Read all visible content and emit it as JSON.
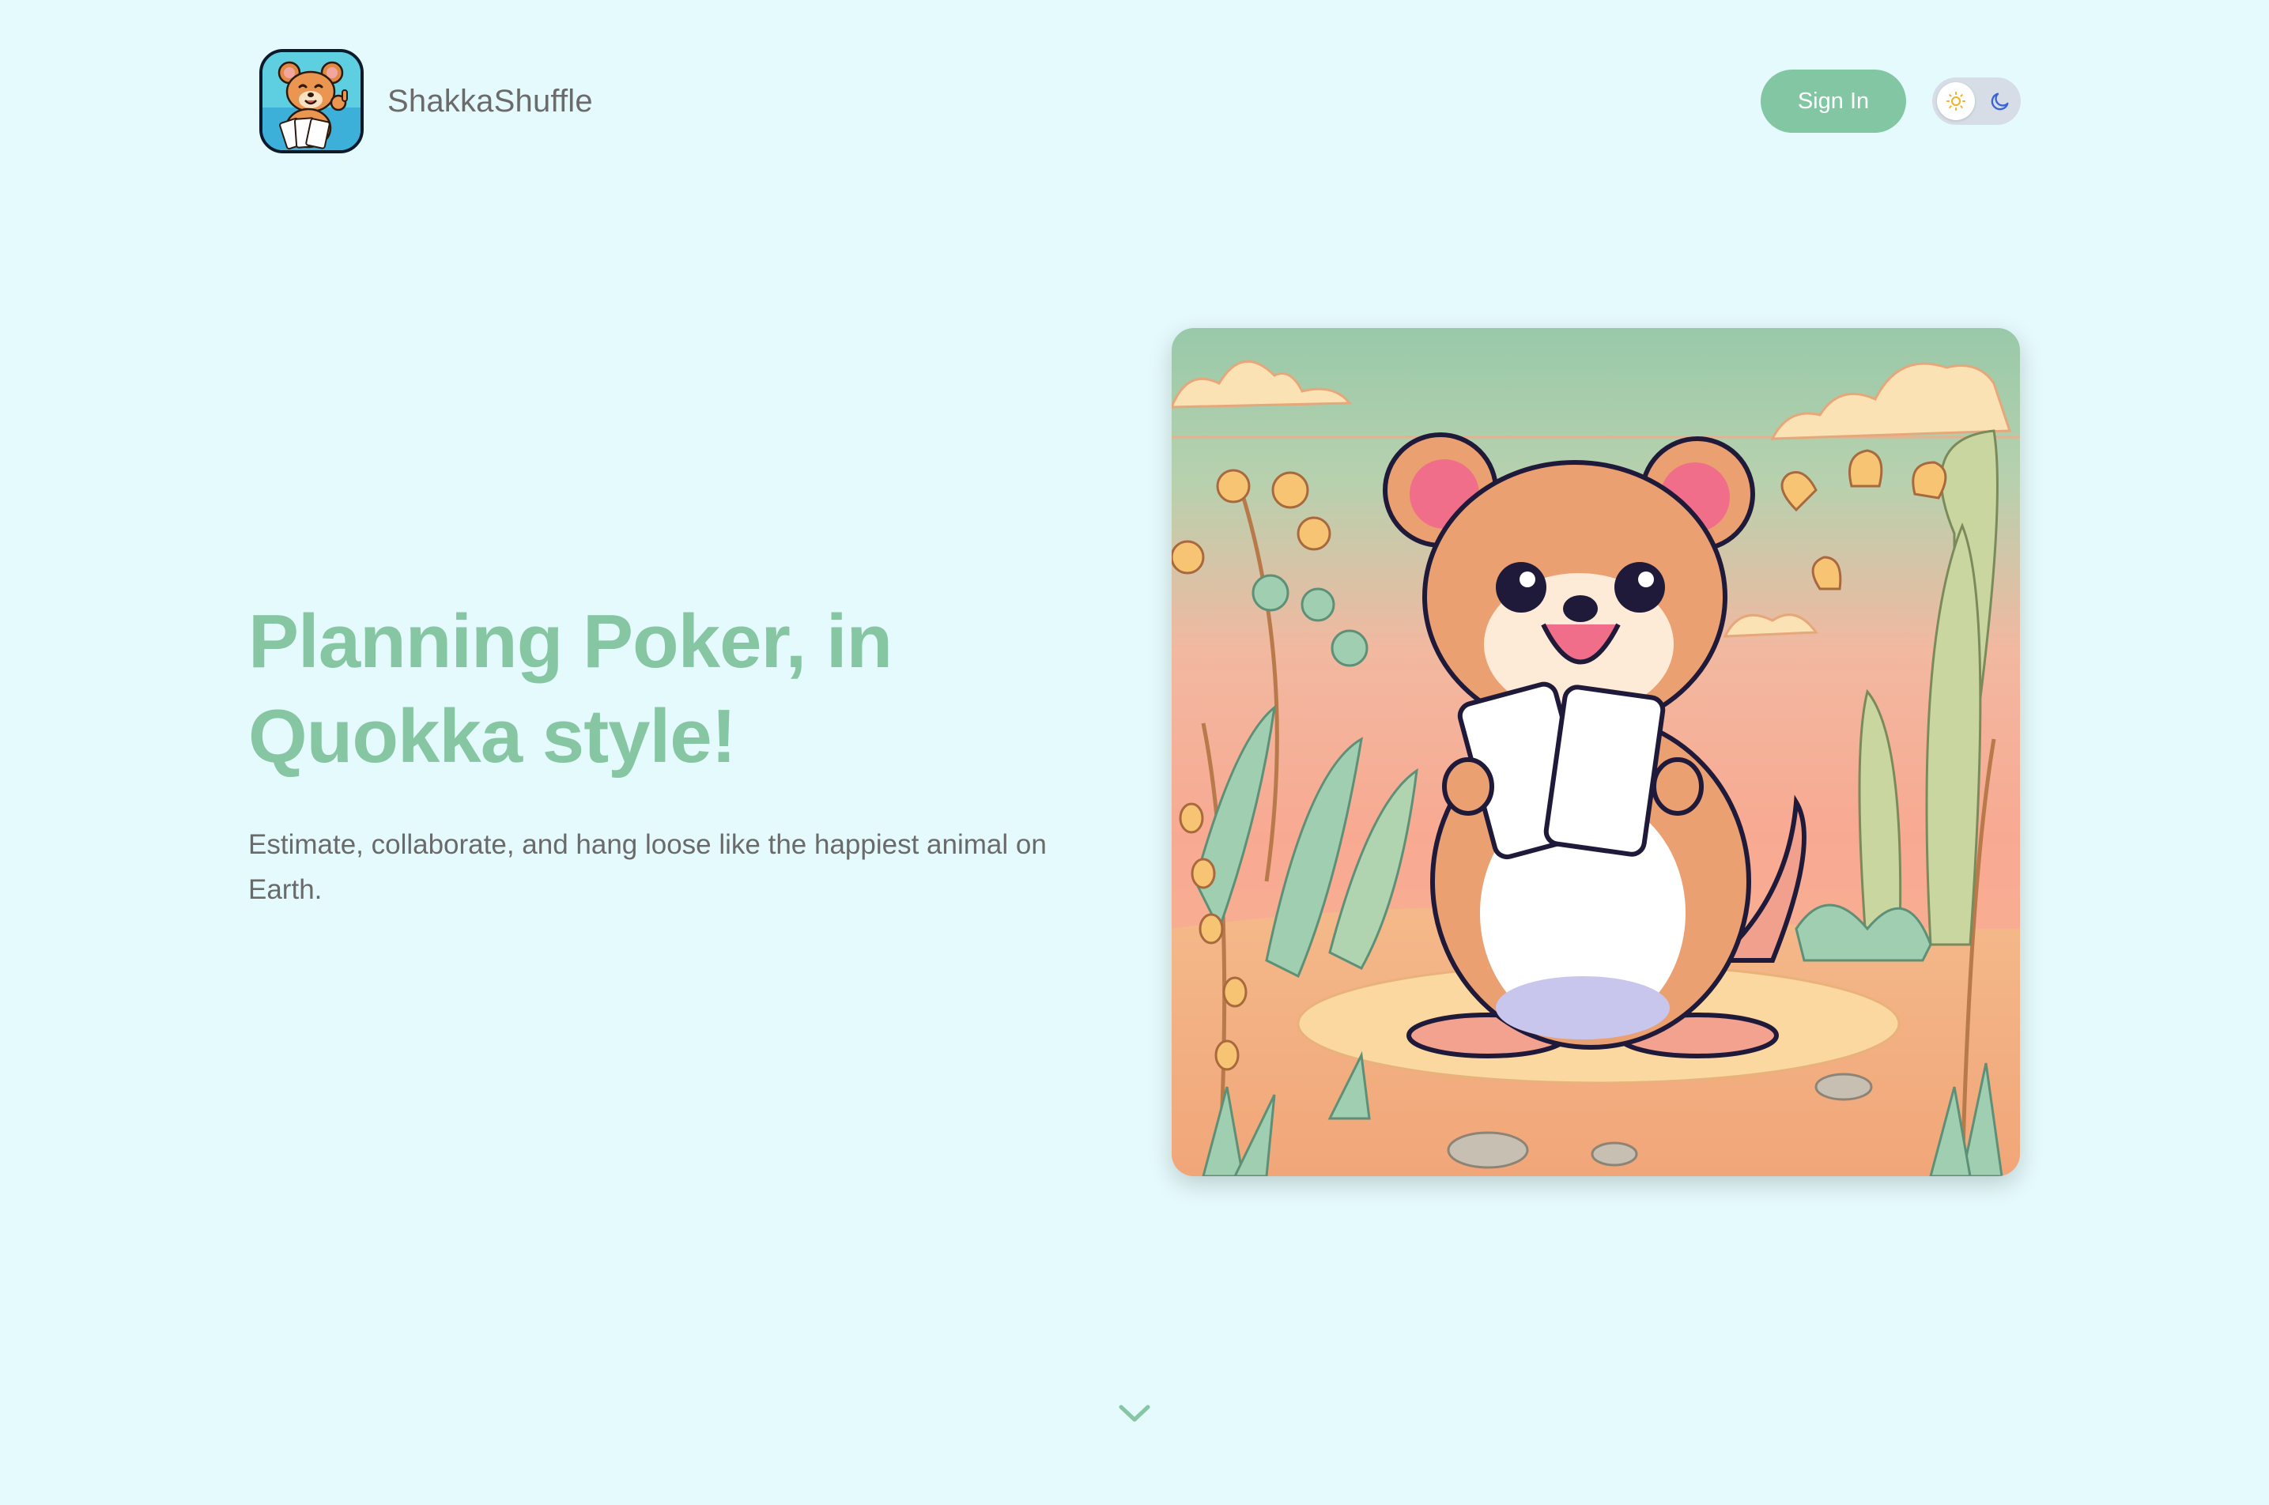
{
  "header": {
    "brand_name": "ShakkaShuffle",
    "logo_icon": "quokka-logo-icon",
    "sign_in_label": "Sign In",
    "theme_toggle": {
      "light_icon": "sun-icon",
      "dark_icon": "moon-icon",
      "selected": "light"
    }
  },
  "hero": {
    "title_line1": "Planning Poker, in",
    "title_line2": "Quokka style!",
    "subtitle": "Estimate, collaborate, and hang loose like the happiest animal on Earth.",
    "illustration": "quokka-holding-cards-illustration"
  },
  "scroll_indicator": {
    "icon": "chevron-down-icon"
  },
  "colors": {
    "background": "#e5fafc",
    "accent_green": "#86c6a3",
    "button_green": "#82c6a3",
    "body_text": "#6a6a6a",
    "brand_text": "#6b6b6b"
  }
}
